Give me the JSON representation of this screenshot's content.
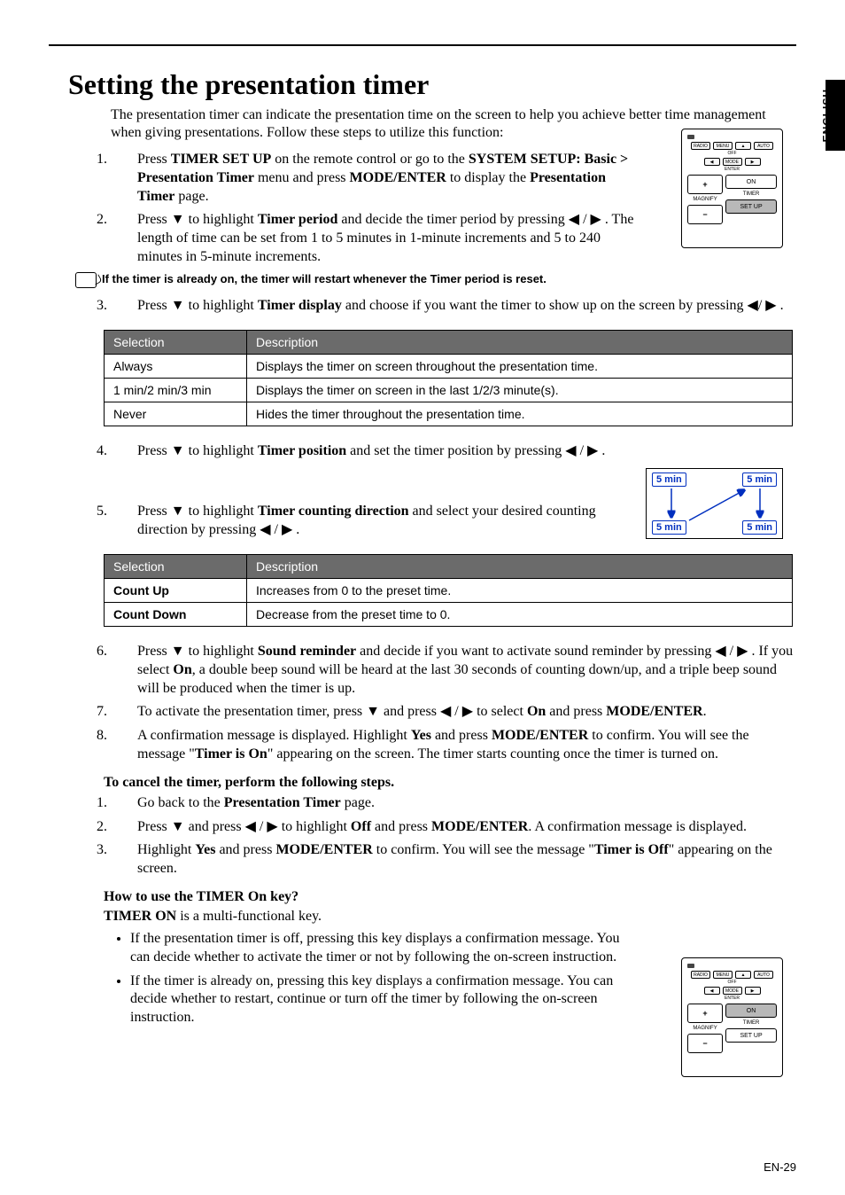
{
  "lang_label": "ENGLISH",
  "title": "Setting the presentation timer",
  "intro": "The presentation timer can indicate the presentation time on the screen to help you achieve better time management when giving presentations. Follow these steps to utilize this function:",
  "step1_a": "Press ",
  "step1_b": "TIMER SET UP",
  "step1_c": " on the remote control or go to the ",
  "step1_d": "SYSTEM SETUP: Basic > Presentation Timer",
  "step1_e": " menu and press ",
  "step1_f": "MODE/ENTER",
  "step1_g": " to display the ",
  "step1_h": "Presentation Timer",
  "step1_i": " page.",
  "step2_a": "Press ",
  "step2_b": " to highlight ",
  "step2_c": "Timer period",
  "step2_d": " and decide the timer period by pressing ",
  "step2_e": " . The length of time can be set from 1 to 5 minutes in 1-minute increments and 5 to 240 minutes in 5-minute increments.",
  "note1": "If the timer is already on, the timer will restart whenever the Timer period is reset.",
  "step3_a": "Press ",
  "step3_b": " to highlight ",
  "step3_c": "Timer display",
  "step3_d": " and choose if you want the timer to show up on the screen by pressing ",
  "step3_e": " .",
  "table1": {
    "h1": "Selection",
    "h2": "Description",
    "r1c1": "Always",
    "r1c2": "Displays the timer on screen throughout the presentation time.",
    "r2c1": "1 min/2 min/3 min",
    "r2c2": "Displays the timer on screen in the last 1/2/3 minute(s).",
    "r3c1": "Never",
    "r3c2": "Hides the timer throughout the presentation time."
  },
  "step4_a": "Press ",
  "step4_b": " to highlight ",
  "step4_c": "Timer position",
  "step4_d": " and set the timer position by pressing ",
  "step4_e": " .",
  "pos_label": "5 min",
  "step5_a": "Press ",
  "step5_b": " to highlight ",
  "step5_c": "Timer counting direction",
  "step5_d": " and select your desired counting direction by pressing ",
  "step5_e": " .",
  "table2": {
    "h1": "Selection",
    "h2": "Description",
    "r1c1": "Count Up",
    "r1c2": "Increases from 0 to the preset time.",
    "r2c1": "Count Down",
    "r2c2": "Decrease from the preset time to 0."
  },
  "step6_a": "Press ",
  "step6_b": " to highlight ",
  "step6_c": "Sound reminder",
  "step6_d": " and decide if you want to activate sound reminder by pressing ",
  "step6_e": " . If you select ",
  "step6_f": "On",
  "step6_g": ", a double beep sound will be heard at the last 30 seconds of counting down/up, and a triple beep sound will be produced when the timer is up.",
  "step7_a": "To activate the presentation timer, press ",
  "step7_b": " and press ",
  "step7_c": " to select ",
  "step7_d": "On",
  "step7_e": " and press ",
  "step7_f": "MODE/ENTER",
  "step7_g": ".",
  "step8_a": "A confirmation message is displayed. Highlight ",
  "step8_b": "Yes",
  "step8_c": " and press ",
  "step8_d": "MODE/ENTER",
  "step8_e": " to confirm. You will see the message \"",
  "step8_f": "Timer is On",
  "step8_g": "\" appearing on the  screen. The timer starts counting once the timer is turned on.",
  "cancel_h": "To cancel the timer, perform the following steps.",
  "c1_a": "Go back to the ",
  "c1_b": "Presentation Timer",
  "c1_c": " page.",
  "c2_a": "Press ",
  "c2_b": " and press ",
  "c2_c": " to highlight ",
  "c2_d": "Off",
  "c2_e": " and press ",
  "c2_f": "MODE/ENTER",
  "c2_g": ". A confirmation message is displayed.",
  "c3_a": "Highlight ",
  "c3_b": "Yes",
  "c3_c": " and press ",
  "c3_d": "MODE/ENTER",
  "c3_e": " to confirm. You will see the message \"",
  "c3_f": "Timer is Off",
  "c3_g": "\" appearing on the screen.",
  "timeron_h": "How to use the TIMER On key?",
  "timeron_sub_a": "TIMER ON",
  "timeron_sub_b": " is a multi-functional key.",
  "to1": "If the presentation timer is off, pressing this key displays a confirmation message. You can decide whether to activate the timer or not by following the on-screen instruction.",
  "to2": "If the timer is already on, pressing this key displays a confirmation message. You can decide whether to restart, continue or turn off the timer by following the on-screen instruction.",
  "remote": {
    "magnify": "MAGNIFY",
    "on": "ON",
    "timer": "TIMER",
    "setup": "SET UP",
    "menu": "MENU",
    "auto": "AUTO",
    "mode": "MODE",
    "enter": "ENTER",
    "off": "OFF",
    "radio": "RADIO"
  },
  "page_num": "EN-29",
  "glyphs": {
    "down": "▼",
    "left": "◀",
    "right": "▶",
    "slash": " / "
  }
}
